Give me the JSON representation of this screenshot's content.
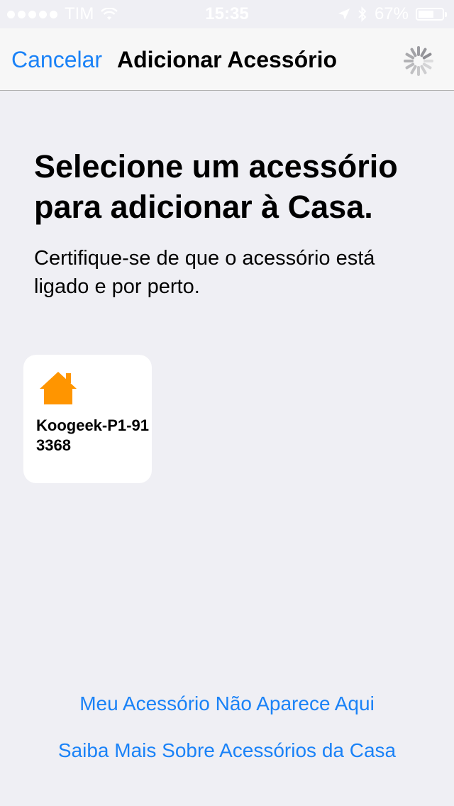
{
  "status_bar": {
    "carrier": "TIM",
    "time": "15:35",
    "battery_percent": "67%",
    "battery_level": 0.67,
    "icons": [
      "signal-dots-icon",
      "wifi-icon",
      "location-arrow-icon",
      "bluetooth-icon",
      "battery-icon"
    ]
  },
  "nav": {
    "cancel_label": "Cancelar",
    "title": "Adicionar Acessório",
    "spinner_icon": "activity-spinner-icon"
  },
  "main": {
    "heading": "Selecione um acessório para adicionar à Casa.",
    "subtext": "Certifique-se de que o acessório está ligado e por perto."
  },
  "accessories": [
    {
      "name": "Koogeek-P1-913368",
      "icon": "house-icon",
      "icon_color": "#ff9500"
    }
  ],
  "links": {
    "not_listed": "Meu Acessório Não Aparece Aqui",
    "learn_more": "Saiba Mais Sobre Acessórios da Casa"
  },
  "colors": {
    "accent": "#1a82f7",
    "background": "#efeff4",
    "tile": "#ffffff",
    "house_icon": "#ff9500"
  }
}
